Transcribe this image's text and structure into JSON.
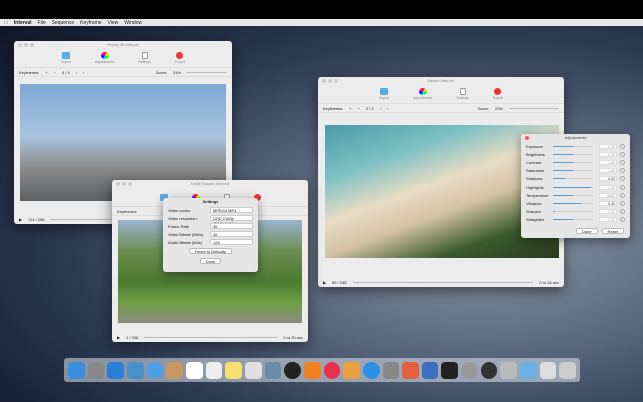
{
  "menubar": {
    "app": "Interval",
    "items": [
      "File",
      "Sequence",
      "Keyframe",
      "View",
      "Window"
    ]
  },
  "toolbar": {
    "import": "Import",
    "adjustments": "Adjustments",
    "settings": "Settings",
    "export": "Export"
  },
  "keyframes_label": "Keyframes:",
  "zoom_label": "Zoom:",
  "windows": [
    {
      "title": "Hourly 30 Interval",
      "frame": "4 / 4",
      "zoom": "31%",
      "counter": "114 / 256",
      "time": ""
    },
    {
      "title": "Beach Interval",
      "frame": "2 / 2",
      "zoom": "20%",
      "counter": "89 / 245",
      "time": "0 m 24 sec"
    },
    {
      "title": "Nellie Square Interval",
      "frame": "",
      "zoom": "",
      "counter": "1 / 208",
      "time": "0 m 20 sec"
    }
  ],
  "settings": {
    "title": "Settings",
    "rows": [
      {
        "label": "Video codec:",
        "value": "MPEG4 MP4"
      },
      {
        "label": "Video resolution:",
        "value": "UHD 2160p (3840x2160)"
      },
      {
        "label": "Frame Rate",
        "value": "30"
      },
      {
        "label": "Video Bitrate (Mb/s)",
        "value": "40"
      },
      {
        "label": "Audio Bitrate (kb/s)",
        "value": "128"
      }
    ],
    "reset": "Reset to Defaults",
    "done": "Done"
  },
  "adjustments": {
    "title": "Adjustments",
    "rows": [
      {
        "label": "Exposure",
        "value": "0.00",
        "fill": 0.5
      },
      {
        "label": "Brightness",
        "value": "0.00",
        "fill": 0.5
      },
      {
        "label": "Contrast",
        "value": "1.00",
        "fill": 0.5
      },
      {
        "label": "Saturation",
        "value": "1.00",
        "fill": 0.5
      },
      {
        "label": "Shadows",
        "value": "0.20",
        "fill": 0.3
      },
      {
        "label": "Highlights",
        "value": "1.00",
        "fill": 0.95
      },
      {
        "label": "Temperature",
        "value": "6500",
        "fill": 0.5
      },
      {
        "label": "Vibrance",
        "value": "0.40",
        "fill": 0.7
      },
      {
        "label": "Sharpen",
        "value": "0.00",
        "fill": 0.05
      },
      {
        "label": "Straighten",
        "value": "0.00",
        "fill": 0.5
      }
    ],
    "done": "Done",
    "reset": "Reset"
  }
}
